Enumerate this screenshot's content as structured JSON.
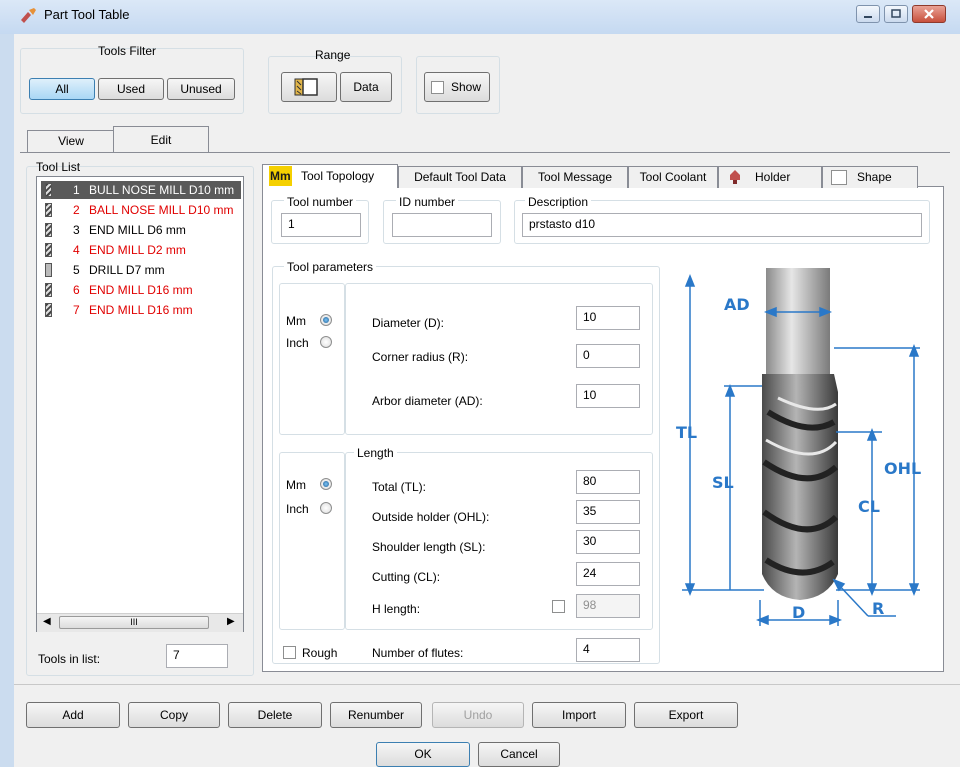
{
  "window": {
    "title": "Part Tool Table"
  },
  "tools_filter": {
    "label": "Tools Filter",
    "all": "All",
    "used": "Used",
    "unused": "Unused"
  },
  "range": {
    "label": "Range",
    "data": "Data"
  },
  "show": {
    "label": "Show"
  },
  "main_tabs": {
    "view": "View",
    "edit": "Edit"
  },
  "tool_list": {
    "label": "Tool List",
    "items": [
      {
        "num": "1",
        "name": "BULL NOSE MILL  D10 mm",
        "color": "#000000"
      },
      {
        "num": "2",
        "name": "BALL NOSE MILL  D10 mm",
        "color": "#e00000"
      },
      {
        "num": "3",
        "name": "END MILL  D6 mm",
        "color": "#000000"
      },
      {
        "num": "4",
        "name": "END MILL  D2 mm",
        "color": "#e00000"
      },
      {
        "num": "5",
        "name": "DRILL  D7 mm",
        "color": "#000000"
      },
      {
        "num": "6",
        "name": "END MILL  D16 mm",
        "color": "#e00000"
      },
      {
        "num": "7",
        "name": "END MILL  D16 mm",
        "color": "#e00000"
      }
    ],
    "tools_in_list_label": "Tools in list:",
    "tools_in_list_value": "7",
    "scroll_thumb": "III"
  },
  "sub_tabs": {
    "tool_topology": "Tool Topology",
    "default_tool_data": "Default Tool Data",
    "tool_message": "Tool Message",
    "tool_coolant": "Tool Coolant",
    "holder": "Holder",
    "shape": "Shape",
    "mm_icon": "Mm"
  },
  "fields": {
    "tool_number_label": "Tool number",
    "tool_number": "1",
    "id_number_label": "ID number",
    "id_number": "",
    "description_label": "Description",
    "description": "prstasto d10"
  },
  "params": {
    "label": "Tool parameters",
    "mm": "Mm",
    "inch": "Inch",
    "diameter_label": "Diameter (D):",
    "diameter": "10",
    "corner_label": "Corner radius (R):",
    "corner": "0",
    "arbor_label": "Arbor diameter (AD):",
    "arbor": "10"
  },
  "length": {
    "label": "Length",
    "mm": "Mm",
    "inch": "Inch",
    "total_label": "Total (TL):",
    "total": "80",
    "ohl_label": "Outside holder (OHL):",
    "ohl": "35",
    "sl_label": "Shoulder length (SL):",
    "sl": "30",
    "cl_label": "Cutting (CL):",
    "cl": "24",
    "h_label": "H length:",
    "h": "98"
  },
  "rough": {
    "label": "Rough"
  },
  "flutes": {
    "label": "Number of flutes:",
    "value": "4"
  },
  "diagram": {
    "ad": "AD",
    "tl": "TL",
    "sl": "SL",
    "ohl": "OHL",
    "cl": "CL",
    "d": "D",
    "r": "R"
  },
  "buttons": {
    "add": "Add",
    "copy": "Copy",
    "delete": "Delete",
    "renumber": "Renumber",
    "undo": "Undo",
    "import": "Import",
    "export": "Export",
    "ok": "OK",
    "cancel": "Cancel"
  },
  "colors": {
    "accent": "#2a78c8",
    "red_text": "#e00000",
    "selection": "#5a5a5a"
  }
}
